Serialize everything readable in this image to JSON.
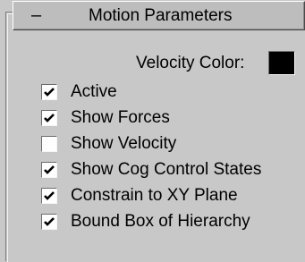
{
  "rollout": {
    "collapse_symbol": "–",
    "title": "Motion Parameters"
  },
  "velocity_color": {
    "label": "Velocity Color:",
    "swatch_color": "#000000"
  },
  "options": [
    {
      "label": "Active",
      "checked": true
    },
    {
      "label": "Show Forces",
      "checked": true
    },
    {
      "label": "Show Velocity",
      "checked": false
    },
    {
      "label": "Show Cog Control States",
      "checked": true
    },
    {
      "label": "Constrain to XY Plane",
      "checked": true
    },
    {
      "label": "Bound Box of Hierarchy",
      "checked": true
    }
  ]
}
